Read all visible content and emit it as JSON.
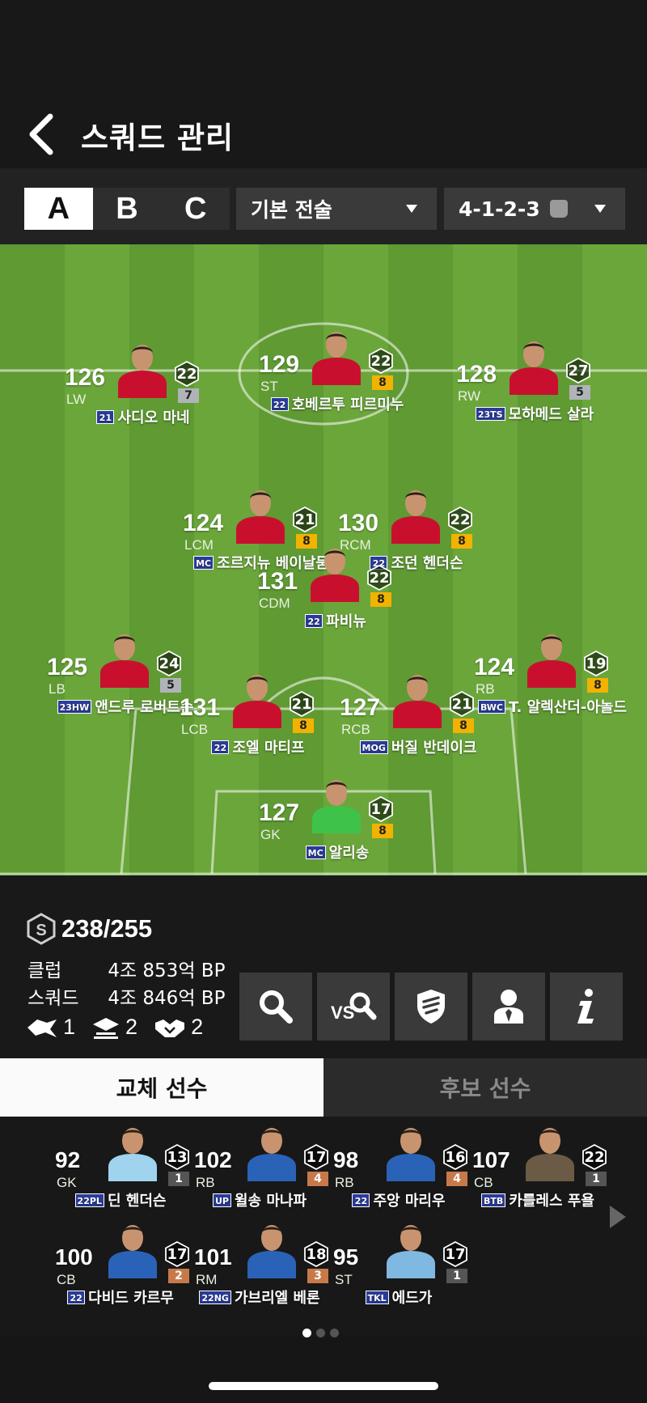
{
  "header": {
    "title": "스쿼드 관리"
  },
  "squad_tabs": [
    "A",
    "B",
    "C"
  ],
  "tactic": {
    "label": "기본 전술"
  },
  "formation": {
    "label": "4-1-2-3"
  },
  "lineup": [
    {
      "ovr": "126",
      "pos": "LW",
      "level": "22",
      "grade": "7",
      "grade_tier": "silver",
      "season": "21",
      "name": "사디오 마네"
    },
    {
      "ovr": "129",
      "pos": "ST",
      "level": "22",
      "grade": "8",
      "grade_tier": "gold",
      "season": "22",
      "name": "호베르투 피르미누"
    },
    {
      "ovr": "128",
      "pos": "RW",
      "level": "27",
      "grade": "5",
      "grade_tier": "silver",
      "season": "23TS",
      "name": "모하메드 살라"
    },
    {
      "ovr": "124",
      "pos": "LCM",
      "level": "21",
      "grade": "8",
      "grade_tier": "gold",
      "season": "MC",
      "name": "조르지뉴 베이날둠"
    },
    {
      "ovr": "130",
      "pos": "RCM",
      "level": "22",
      "grade": "8",
      "grade_tier": "gold",
      "season": "22",
      "name": "조던 헨더슨"
    },
    {
      "ovr": "131",
      "pos": "CDM",
      "level": "22",
      "grade": "8",
      "grade_tier": "gold",
      "season": "22",
      "name": "파비뉴"
    },
    {
      "ovr": "125",
      "pos": "LB",
      "level": "24",
      "grade": "5",
      "grade_tier": "silver",
      "season": "23HW",
      "name": "앤드루 로버트슨"
    },
    {
      "ovr": "131",
      "pos": "LCB",
      "level": "21",
      "grade": "8",
      "grade_tier": "gold",
      "season": "22",
      "name": "조엘 마티프"
    },
    {
      "ovr": "127",
      "pos": "RCB",
      "level": "21",
      "grade": "8",
      "grade_tier": "gold",
      "season": "MOG",
      "name": "버질 반데이크"
    },
    {
      "ovr": "124",
      "pos": "RB",
      "level": "19",
      "grade": "8",
      "grade_tier": "gold",
      "season": "BWC",
      "name": "T. 알렉산더-아놀드"
    },
    {
      "ovr": "127",
      "pos": "GK",
      "level": "17",
      "grade": "8",
      "grade_tier": "gold",
      "season": "MC",
      "name": "알리송"
    }
  ],
  "stats": {
    "salary": "238/255",
    "club_label": "클럽",
    "club_value": "4조 853억 BP",
    "squad_label": "스쿼드",
    "squad_value": "4조 846억 BP",
    "chem": [
      "1",
      "2",
      "2"
    ]
  },
  "bench_tabs": {
    "subs": "교체 선수",
    "reserves": "후보 선수"
  },
  "bench": [
    {
      "ovr": "92",
      "pos": "GK",
      "level": "13",
      "grade": "1",
      "grade_tier": "dark",
      "season": "22PL",
      "name": "딘 헨더슨"
    },
    {
      "ovr": "102",
      "pos": "RB",
      "level": "17",
      "grade": "4",
      "grade_tier": "bronze",
      "season": "UP",
      "name": "윌송 마나파"
    },
    {
      "ovr": "98",
      "pos": "RB",
      "level": "16",
      "grade": "4",
      "grade_tier": "bronze",
      "season": "22",
      "name": "주앙 마리우"
    },
    {
      "ovr": "107",
      "pos": "CB",
      "level": "22",
      "grade": "1",
      "grade_tier": "dark",
      "season": "BTB",
      "name": "카를레스 푸욜"
    },
    {
      "ovr": "100",
      "pos": "CB",
      "level": "17",
      "grade": "2",
      "grade_tier": "bronze",
      "season": "22",
      "name": "다비드 카르무"
    },
    {
      "ovr": "101",
      "pos": "RM",
      "level": "18",
      "grade": "3",
      "grade_tier": "bronze",
      "season": "22NG",
      "name": "가브리엘 베론"
    },
    {
      "ovr": "95",
      "pos": "ST",
      "level": "17",
      "grade": "1",
      "grade_tier": "dark",
      "season": "TKL",
      "name": "에드가"
    }
  ]
}
